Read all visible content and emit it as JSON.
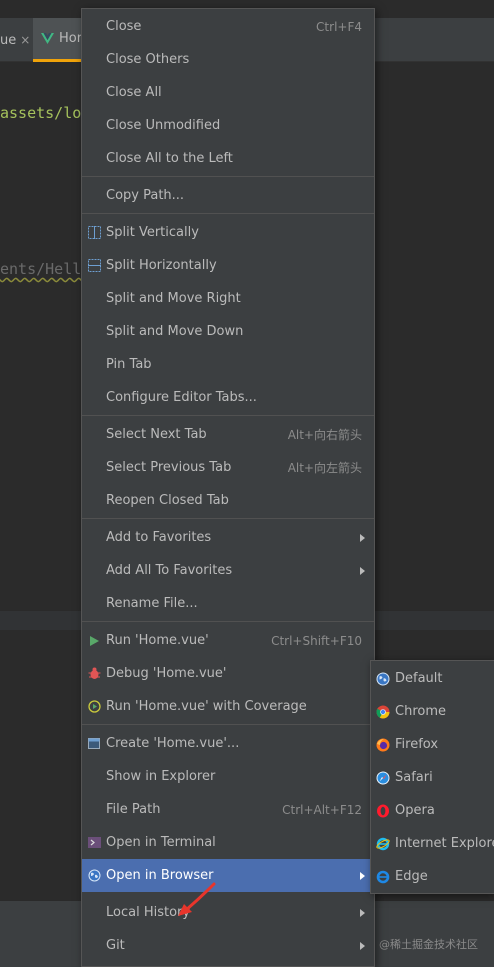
{
  "editor": {
    "tab_partial_label": "ue",
    "tab_close": "×",
    "active_tab_label": "Hor",
    "code_line_1": "assets/lo",
    "code_line_2": "ents/Hell"
  },
  "context_menu": {
    "items": [
      {
        "label": "Close",
        "shortcut": "Ctrl+F4"
      },
      {
        "label": "Close Others"
      },
      {
        "label": "Close All"
      },
      {
        "label": "Close Unmodified"
      },
      {
        "label": "Close All to the Left"
      },
      {
        "label": "Copy Path..."
      },
      {
        "label": "Split Vertically",
        "icon": "split-vertically-icon"
      },
      {
        "label": "Split Horizontally",
        "icon": "split-horizontally-icon"
      },
      {
        "label": "Split and Move Right"
      },
      {
        "label": "Split and Move Down"
      },
      {
        "label": "Pin Tab"
      },
      {
        "label": "Configure Editor Tabs..."
      },
      {
        "label": "Select Next Tab",
        "shortcut": "Alt+向右箭头"
      },
      {
        "label": "Select Previous Tab",
        "shortcut": "Alt+向左箭头"
      },
      {
        "label": "Reopen Closed Tab"
      },
      {
        "label": "Add to Favorites",
        "submenu": true
      },
      {
        "label": "Add All To Favorites",
        "submenu": true
      },
      {
        "label": "Rename File..."
      },
      {
        "label": "Run 'Home.vue'",
        "shortcut": "Ctrl+Shift+F10",
        "icon": "run-icon"
      },
      {
        "label": "Debug 'Home.vue'",
        "icon": "debug-icon"
      },
      {
        "label": "Run 'Home.vue' with Coverage",
        "icon": "coverage-icon"
      },
      {
        "label": "Create 'Home.vue'...",
        "icon": "create-config-icon"
      },
      {
        "label": "Show in Explorer"
      },
      {
        "label": "File Path",
        "shortcut": "Ctrl+Alt+F12"
      },
      {
        "label": "Open in Terminal",
        "icon": "terminal-icon"
      },
      {
        "label": "Open in Browser",
        "submenu": true,
        "selected": true,
        "icon": "globe-icon"
      },
      {
        "label": "Local History",
        "submenu": true
      },
      {
        "label": "Git",
        "submenu": true
      }
    ]
  },
  "browser_submenu": {
    "items": [
      {
        "label": "Default",
        "icon": "globe-icon"
      },
      {
        "label": "Chrome",
        "icon": "chrome-icon"
      },
      {
        "label": "Firefox",
        "icon": "firefox-icon"
      },
      {
        "label": "Safari",
        "icon": "safari-icon"
      },
      {
        "label": "Opera",
        "icon": "opera-icon"
      },
      {
        "label": "Internet Explorer",
        "icon": "internet-explorer-icon"
      },
      {
        "label": "Edge",
        "icon": "edge-icon"
      }
    ]
  },
  "watermark": "@稀土掘金技术社区",
  "colors": {
    "menu_bg": "#3c3f41",
    "selection": "#4b6eaf",
    "active_tab_underline": "#f0a30a",
    "annotation_arrow": "#e8352b"
  }
}
